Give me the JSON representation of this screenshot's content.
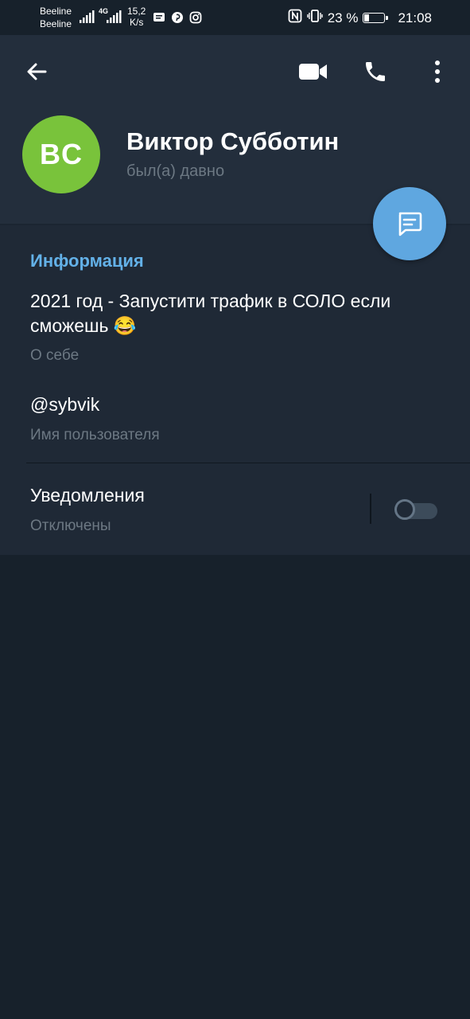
{
  "status_bar": {
    "carrier_1": "Beeline",
    "carrier_2": "Beeline",
    "network_type": "4G",
    "speed_value": "15,2",
    "speed_unit": "K/s",
    "battery_percent": "23 %",
    "battery_level": 0.23,
    "time": "21:08"
  },
  "profile": {
    "initials": "BC",
    "name": "Виктор Субботин",
    "last_seen": "был(а) давно",
    "avatar_color": "#79c33b"
  },
  "info": {
    "section_title": "Информация",
    "bio": "2021 год - Запустити трафик в СОЛО если сможешь 😂",
    "bio_label": "О себе",
    "username": "@sybvik",
    "username_label": "Имя пользователя",
    "notifications_label": "Уведомления",
    "notifications_state": "Отключены",
    "notifications_enabled": false
  },
  "colors": {
    "accent": "#63b1e8",
    "fab": "#5fa7e0",
    "header_bg": "#232e3c",
    "page_bg": "#17212b"
  }
}
